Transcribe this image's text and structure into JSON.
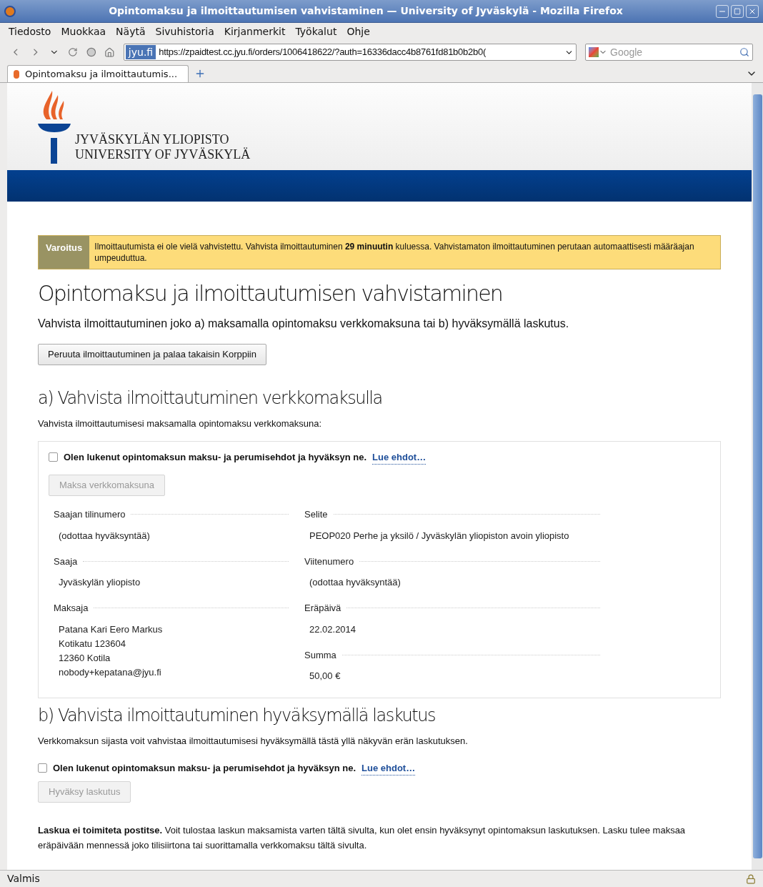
{
  "window": {
    "title": "Opintomaksu ja ilmoittautumisen vahvistaminen — University of Jyväskylä - Mozilla Firefox"
  },
  "menu": [
    "Tiedosto",
    "Muokkaa",
    "Näytä",
    "Sivuhistoria",
    "Kirjanmerkit",
    "Työkalut",
    "Ohje"
  ],
  "toolbar": {
    "site_identity": "jyu.fi",
    "url": "https://zpaidtest.cc.jyu.fi/orders/1006418622/?auth=16336dacc4b8761fd81b0b2b0(",
    "search_placeholder": "Google"
  },
  "tabs": [
    {
      "label": "Opintomaksu ja ilmoittautumis...",
      "selected": true
    }
  ],
  "header": {
    "logo_lines": [
      "JYVÄSKYLÄN YLIOPISTO",
      "UNIVERSITY OF JYVÄSKYLÄ"
    ]
  },
  "warning": {
    "label": "Varoitus",
    "text": "Ilmoittautumista ei ole vielä vahvistettu. Vahvista ilmoittautuminen **29 minuutin** kuluessa. Vahvistamaton ilmoittautuminen perutaan automaattisesti määräajan umpeuduttua."
  },
  "heading": "Opintomaksu ja ilmoittautumisen vahvistaminen",
  "intro": "Vahvista ilmoittautuminen joko a) maksamalla opintomaksu verkkomaksuna tai b) hyväksymällä laskutus.",
  "cancel_button": "Peruuta ilmoittautuminen ja palaa takaisin Korppiin",
  "section_a": {
    "heading": "a) Vahvista ilmoittautuminen verkkomaksulla",
    "intro": "Vahvista ilmoittautumisesi maksamalla opintomaksu verkkomaksuna:",
    "terms": {
      "text": "Olen lukenut opintomaksun maksu- ja perumisehdot ja hyväksyn ne.",
      "link": "Lue ehdot…",
      "checked": false
    },
    "button": {
      "label": "Maksa verkkomaksuna",
      "disabled": true
    },
    "fields_left": [
      {
        "label": "Saajan tilinumero",
        "values": [
          "(odottaa hyväksyntää)"
        ]
      },
      {
        "label": "Saaja",
        "values": [
          "Jyväskylän yliopisto"
        ]
      },
      {
        "label": "Maksaja",
        "values": [
          "Patana Kari Eero Markus",
          "Kotikatu 123604",
          "12360 Kotila",
          "nobody+kepatana@jyu.fi"
        ]
      }
    ],
    "fields_right": [
      {
        "label": "Selite",
        "values": [
          "PEOP020 Perhe ja yksilö / Jyväskylän yliopiston avoin yliopisto"
        ]
      },
      {
        "label": "Viitenumero",
        "values": [
          "(odottaa hyväksyntää)"
        ]
      },
      {
        "label": "Eräpäivä",
        "values": [
          "22.02.2014"
        ]
      },
      {
        "label": "Summa",
        "values": [
          "50,00 €"
        ]
      }
    ]
  },
  "section_b": {
    "heading": "b) Vahvista ilmoittautuminen hyväksymällä laskutus",
    "intro": "Verkkomaksun sijasta voit vahvistaa ilmoittautumisesi hyväksymällä tästä yllä näkyvän erän laskutuksen.",
    "terms": {
      "text": "Olen lukenut opintomaksun maksu- ja perumisehdot ja hyväksyn ne.",
      "link": "Lue ehdot…",
      "checked": false
    },
    "button": {
      "label": "Hyväksy laskutus",
      "disabled": true
    }
  },
  "footer_note": "**Laskua ei toimiteta postitse.** Voit tulostaa laskun maksamista varten tältä sivulta, kun olet ensin hyväksynyt opintomaksun laskutuksen. Lasku tulee maksaa eräpäivään mennessä joko tilisiirtona tai suorittamalla verkkomaksu tältä sivulta.",
  "status_bar": "Valmis"
}
